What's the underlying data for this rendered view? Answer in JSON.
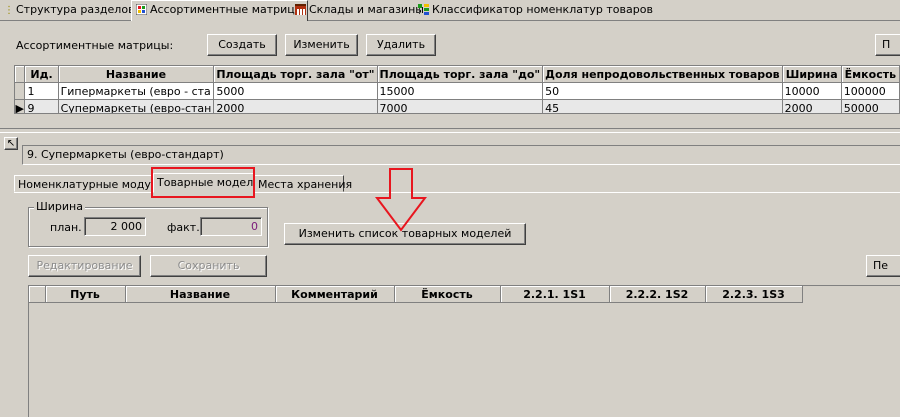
{
  "top_tabs": [
    {
      "label": "Структура разделов",
      "icon": "structure-icon"
    },
    {
      "label": "Ассортиментные матрицы",
      "icon": "matrix-icon"
    },
    {
      "label": "Склады и магазины",
      "icon": "warehouse-icon"
    },
    {
      "label": "Классификатор номенклатур товаров",
      "icon": "classifier-icon"
    }
  ],
  "matrices": {
    "label": "Ассортиментные матрицы:",
    "create": "Создать",
    "edit": "Изменить",
    "delete": "Удалить",
    "right_btn": "П",
    "columns": [
      "Ид.",
      "Название",
      "Площадь торг. зала \"от\"",
      "Площадь торг. зала \"до\"",
      "Доля непродовольственных товаров",
      "Ширина",
      "Ёмкость"
    ],
    "rows": [
      [
        "1",
        "Гипермаркеты (евро - ста",
        "5000",
        "15000",
        "50",
        "10000",
        "100000"
      ],
      [
        "9",
        "Супермаркеты (евро-стан",
        "2000",
        "7000",
        "45",
        "2000",
        "50000"
      ]
    ],
    "selected_row": 1
  },
  "detail": {
    "collapse_icon": "↖",
    "title": "9. Супермаркеты (евро-стандарт)",
    "tabs": [
      "Номенклатурные модули",
      "Товарные модели",
      "Места хранения"
    ],
    "active_tab": 1,
    "width_group": "Ширина",
    "plan_label": "план.",
    "plan_value": "2 000",
    "fact_label": "факт.",
    "fact_value": "0",
    "change_models": "Изменить список товарных моделей",
    "edit_btn": "Редактирование",
    "save_btn": "Сохранить",
    "right_btn": "Пе",
    "columns": [
      "Путь",
      "Название",
      "Комментарий",
      "Ёмкость",
      "2.2.1. 1S1",
      "2.2.2. 1S2",
      "2.2.3. 1S3"
    ]
  },
  "colors": {
    "highlight": "#e8161f"
  }
}
